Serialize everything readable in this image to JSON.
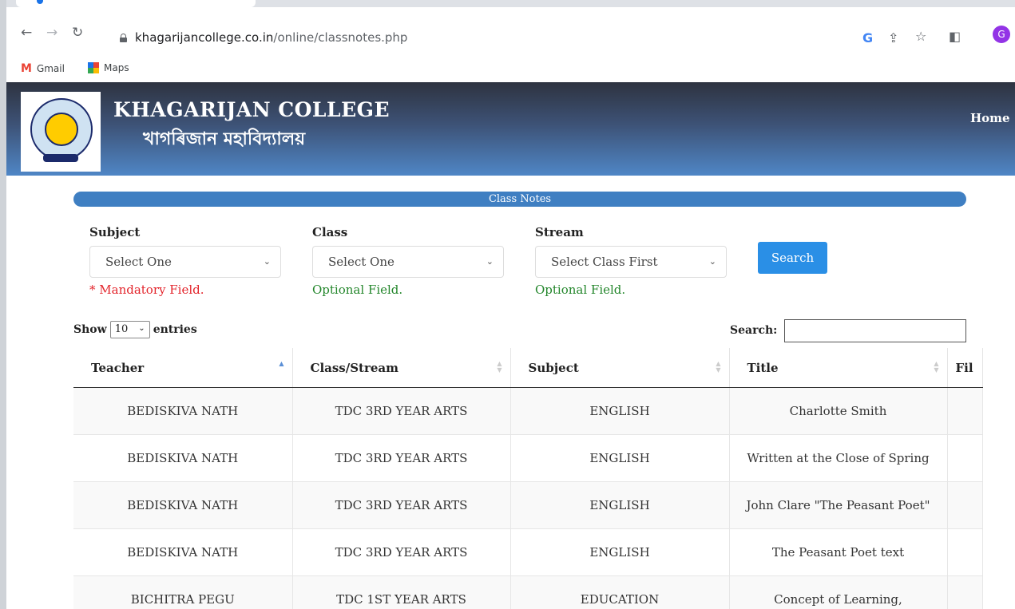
{
  "browser": {
    "url_domain": "khagarijancollege.co.in",
    "url_path": "/online/classnotes.php",
    "profile_initial": "G",
    "bookmarks": [
      {
        "label": "Gmail",
        "icon": "gmail-icon"
      },
      {
        "label": "Maps",
        "icon": "maps-icon"
      }
    ]
  },
  "header": {
    "college_name": "KHAGARIJAN COLLEGE",
    "college_name_bn": "খাগৰিজান মহাবিদ্যালয়",
    "home_label": "Home"
  },
  "section_title": "Class Notes",
  "filters": {
    "subject": {
      "label": "Subject",
      "value": "Select One",
      "hint": "* Mandatory Field."
    },
    "class": {
      "label": "Class",
      "value": "Select One",
      "hint": "Optional Field."
    },
    "stream": {
      "label": "Stream",
      "value": "Select Class First",
      "hint": "Optional Field."
    },
    "search_button": "Search"
  },
  "datatable": {
    "show_label": "Show",
    "entries_value": "10",
    "entries_label": "entries",
    "search_label": "Search:",
    "columns": [
      "Teacher",
      "Class/Stream",
      "Subject",
      "Title",
      "Fil"
    ],
    "rows": [
      {
        "teacher": "BEDISKIVA NATH",
        "class_stream": "TDC 3RD YEAR ARTS",
        "subject": "ENGLISH",
        "title": "Charlotte Smith"
      },
      {
        "teacher": "BEDISKIVA NATH",
        "class_stream": "TDC 3RD YEAR ARTS",
        "subject": "ENGLISH",
        "title": "Written at the Close of Spring"
      },
      {
        "teacher": "BEDISKIVA NATH",
        "class_stream": "TDC 3RD YEAR ARTS",
        "subject": "ENGLISH",
        "title": "John Clare \"The Peasant Poet\""
      },
      {
        "teacher": "BEDISKIVA NATH",
        "class_stream": "TDC 3RD YEAR ARTS",
        "subject": "ENGLISH",
        "title": "The Peasant Poet text"
      },
      {
        "teacher": "BICHITRA PEGU",
        "class_stream": "TDC 1ST YEAR ARTS",
        "subject": "EDUCATION",
        "title": "Concept of Learning,"
      }
    ]
  }
}
